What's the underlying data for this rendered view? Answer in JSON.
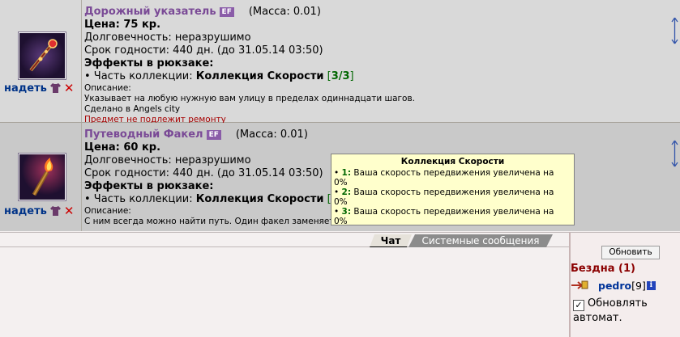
{
  "items": [
    {
      "title": "Дорожный указатель",
      "badge": "EF",
      "mass": "(Масса: 0.01)",
      "price": "Цена: 75 кр.",
      "durability": "Долговечность: неразрушимо",
      "expiry": "Срок годности: 440 дн. (до 31.05.14 03:50)",
      "effects_header": "Эффекты в рюкзаке:",
      "collection_prefix": "• Часть коллекции:",
      "collection_name": "Коллекция Скорости",
      "collection_bracket_open": "[",
      "collection_count": "3/3",
      "collection_bracket_close": "]",
      "desc_label": "Описание:",
      "desc_text": "Указывает на любую нужную вам улицу в пределах одиннадцати шагов.",
      "made_in": "Сделано в Angels city",
      "repair_note": "Предмет не подлежит ремонту",
      "action_label": "надеть",
      "icon": "scepter-icon"
    },
    {
      "title": "Путеводный Факел",
      "badge": "EF",
      "mass": "(Масса: 0.01)",
      "price": "Цена: 60 кр.",
      "durability": "Долговечность: неразрушимо",
      "expiry": "Срок годности: 440 дн. (до 31.05.14 03:50)",
      "effects_header": "Эффекты в рюкзаке:",
      "collection_prefix": "• Часть коллекции:",
      "collection_name": "Коллекция Скорости",
      "collection_bracket_open": "[",
      "desc_label": "Описание:",
      "desc_text": "С ним всегда можно найти путь. Один факел заменяет",
      "action_label": "надеть",
      "icon": "torch-icon"
    }
  ],
  "tooltip": {
    "title": "Коллекция Скорости",
    "lines": [
      {
        "num": "1:",
        "text": "Ваша скорость передвижения увеличена на",
        "cont": "0%"
      },
      {
        "num": "2:",
        "text": "Ваша скорость передвижения увеличена на",
        "cont": "0%"
      },
      {
        "num": "3:",
        "text": "Ваша скорость передвижения увеличена на",
        "cont": "0%"
      }
    ]
  },
  "chat": {
    "tabs": [
      "Чат",
      "Системные сообщения"
    ]
  },
  "right_panel": {
    "refresh_label": "Обновить",
    "location": "Бездна (1)",
    "user_name": "pedro",
    "user_level": "[9]",
    "info_glyph": "i",
    "autoupdate_label": "Обновлять автомат.",
    "autoupdate_checked": true
  },
  "colors": {
    "item_title": "#7a4a96",
    "collection_count": "#006600",
    "location": "#8b0000",
    "tooltip_bg": "#ffffcc"
  }
}
